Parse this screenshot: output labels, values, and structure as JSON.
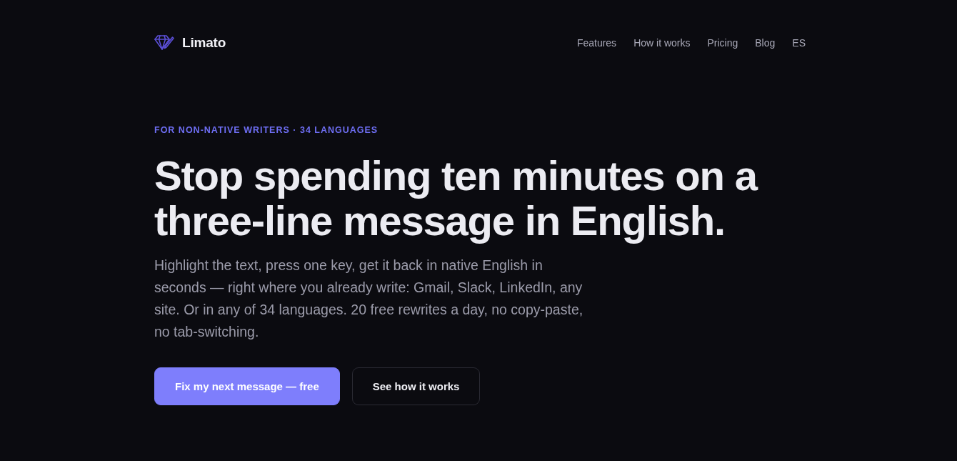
{
  "header": {
    "logo": {
      "name": "Limato"
    },
    "nav": [
      {
        "label": "Features"
      },
      {
        "label": "How it works"
      },
      {
        "label": "Pricing"
      },
      {
        "label": "Blog"
      },
      {
        "label": "ES"
      }
    ]
  },
  "hero": {
    "eyebrow": "FOR NON-NATIVE WRITERS · 34 LANGUAGES",
    "headline": [
      "Stop spending ten minutes on a",
      "three-line message in English."
    ],
    "description": "Highlight the text, press one key, get it back in native English in seconds — right where you already write: Gmail, Slack, LinkedIn, any site. Or in any of 34 languages. 20 free rewrites a day, no copy-paste, no tab-switching.",
    "buttons": [
      {
        "label": "Fix my next message — free",
        "kind": "primary"
      },
      {
        "label": "See how it works",
        "kind": "secondary"
      }
    ]
  }
}
